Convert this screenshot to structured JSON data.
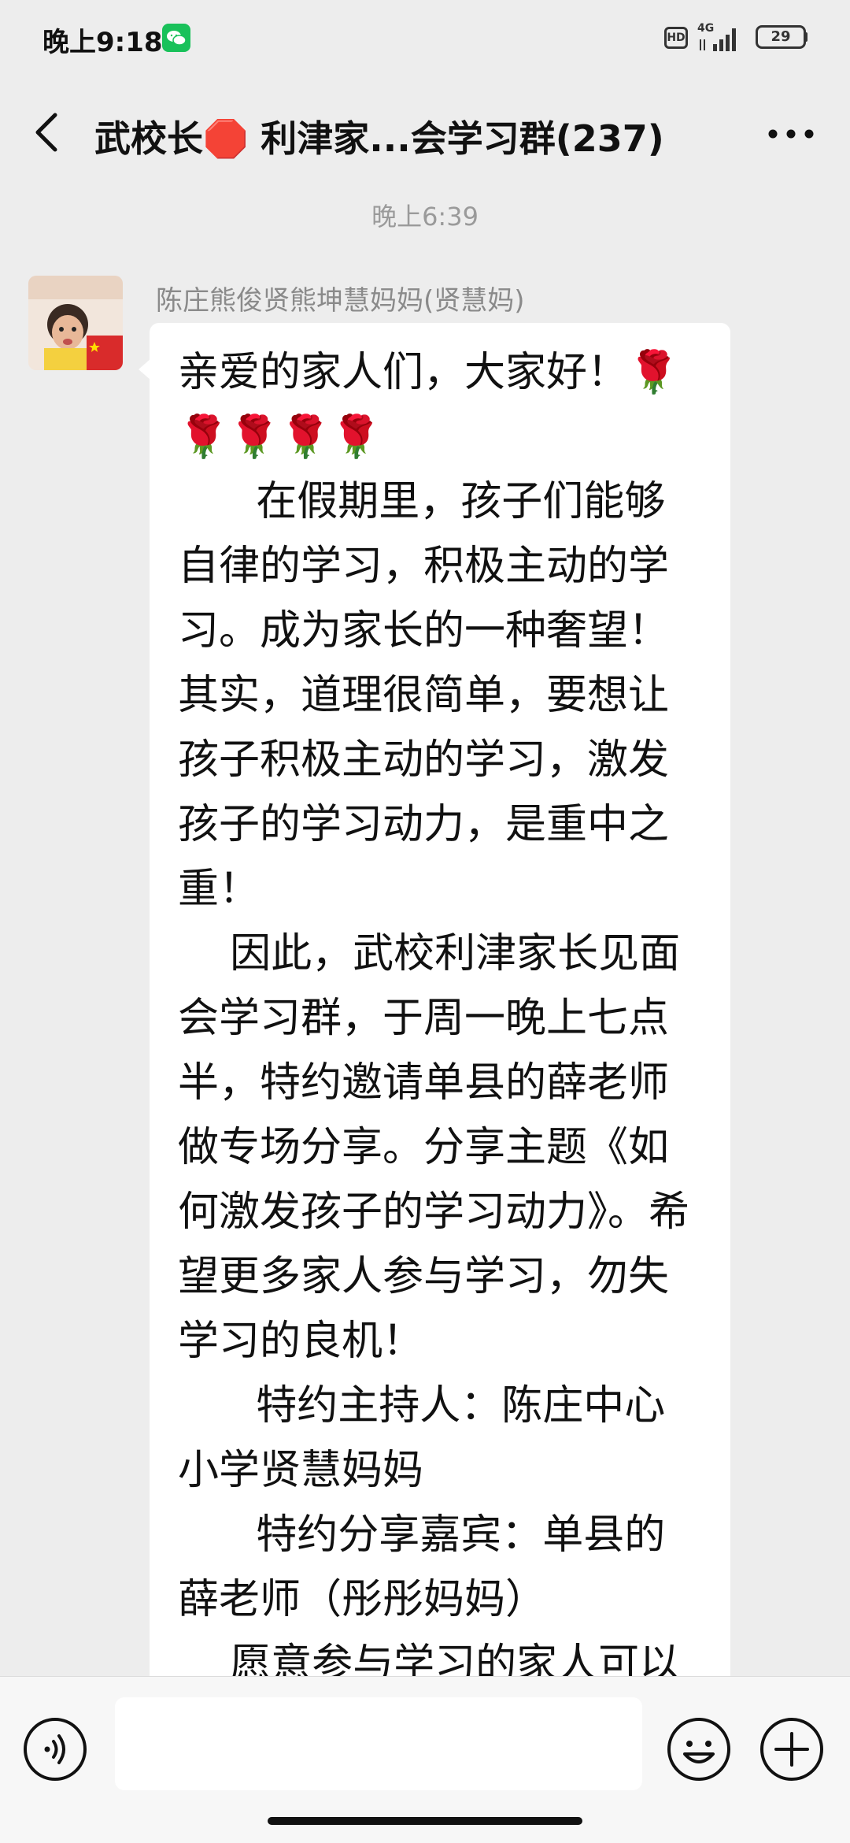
{
  "status_bar": {
    "time": "晚上9:18",
    "hd_label": "HD",
    "network_label": "4G",
    "battery_level": "29",
    "notification_icon": "wechat-icon"
  },
  "nav": {
    "back_icon": "chevron-left-icon",
    "title": "武校长🛑 利津家...会学习群(237)",
    "more_icon": "more-dots-icon"
  },
  "chat": {
    "time_divider": "晚上6:39",
    "message": {
      "sender": "陈庄熊俊贤熊坤慧妈妈(贤慧妈)",
      "text": "亲爱的家人们，大家好！🌹\n🌹🌹🌹🌹\n      在假期里，孩子们能够自律的学习，积极主动的学习。成为家长的一种奢望！其实，道理很简单，要想让孩子积极主动的学习，激发孩子的学习动力，是重中之重！\n    因此，武校利津家长见面会学习群，于周一晚上七点半，特约邀请单县的薛老师做专场分享。分享主题《如何激发孩子的学习动力》。希望更多家人参与学习，勿失学习的良机！\n      特约主持人：陈庄中心小学贤慧妈妈\n      特约分享嘉宾：单县的薛老师（彤彤妈妈）\n    愿意参与学习的家人可以"
    }
  },
  "input_bar": {
    "voice_icon": "voice-icon",
    "input_value": "",
    "emoji_icon": "emoji-icon",
    "plus_icon": "plus-icon"
  },
  "colors": {
    "background": "#ededed",
    "bubble": "#ffffff",
    "wechat_green": "#19c15a",
    "muted_text": "#9a9a9a"
  }
}
